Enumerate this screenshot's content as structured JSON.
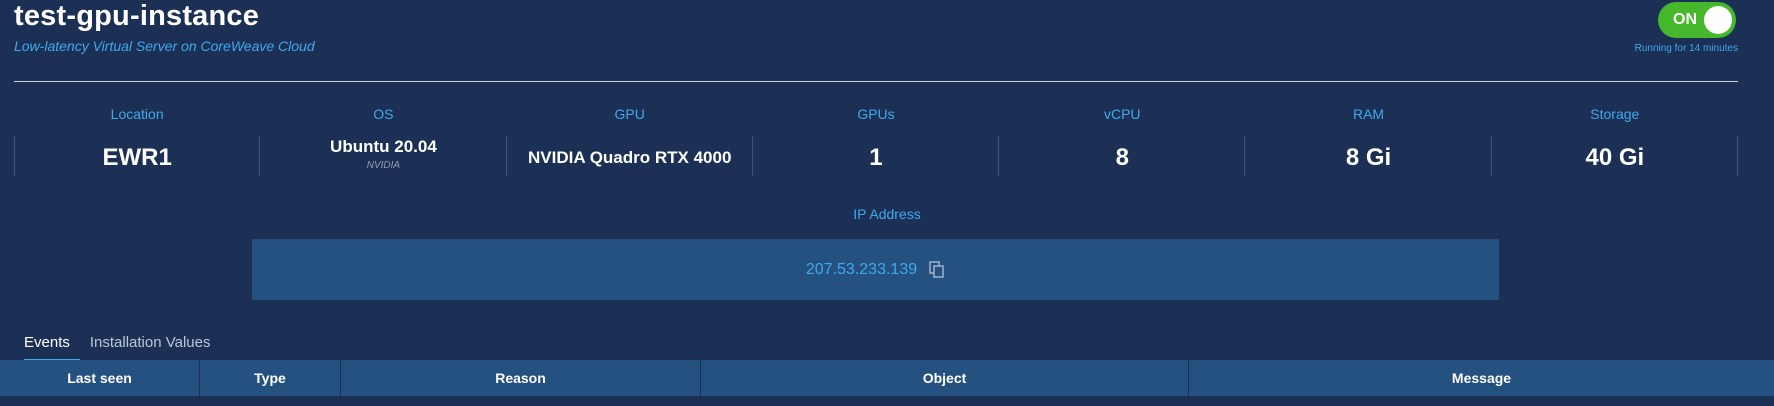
{
  "header": {
    "title": "test-gpu-instance",
    "subtitle": "Low-latency Virtual Server on CoreWeave Cloud",
    "toggle_label": "ON",
    "runtime": "Running for 14 minutes"
  },
  "specs": [
    {
      "label": "Location",
      "value": "EWR1"
    },
    {
      "label": "OS",
      "value": "Ubuntu 20.04",
      "sub": "NVIDIA"
    },
    {
      "label": "GPU",
      "value": "NVIDIA Quadro RTX 4000"
    },
    {
      "label": "GPUs",
      "value": "1"
    },
    {
      "label": "vCPU",
      "value": "8"
    },
    {
      "label": "RAM",
      "value": "8 Gi"
    },
    {
      "label": "Storage",
      "value": "40 Gi"
    }
  ],
  "ip": {
    "label": "IP Address",
    "value": "207.53.233.139"
  },
  "tabs": [
    "Events",
    "Installation Values"
  ],
  "table": {
    "columns": [
      "Last seen",
      "Type",
      "Reason",
      "Object",
      "Message"
    ]
  },
  "colors": {
    "background": "#1c3055",
    "accent": "#3fa9ec",
    "toggle_on": "#46b82c",
    "panel": "#24517f"
  }
}
